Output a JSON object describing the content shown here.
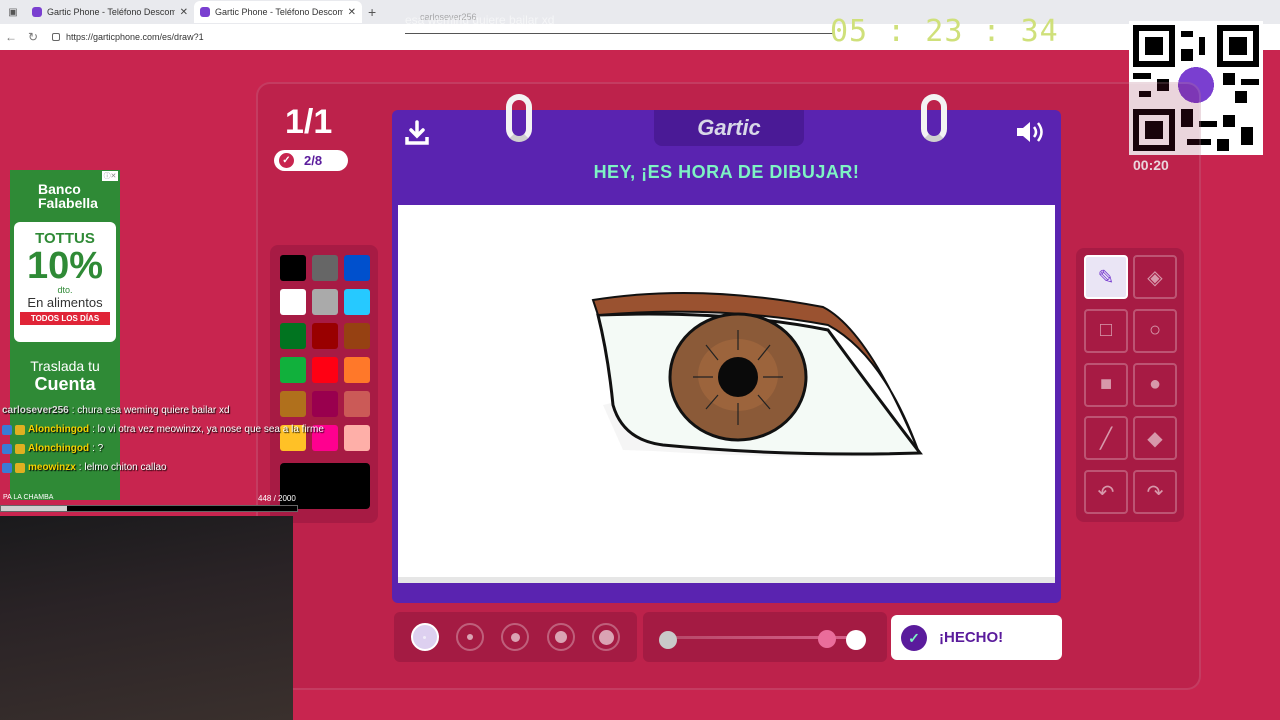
{
  "browser": {
    "tabs": [
      {
        "title": "Gartic Phone - Teléfono Descomp",
        "active": false
      },
      {
        "title": "Gartic Phone - Teléfono Descomp",
        "active": true
      }
    ],
    "url": "https://garticphone.com/es/draw?1"
  },
  "overlay": {
    "marquee": "esa weming quiere bailar xd",
    "marquee_user": "carlosever256",
    "stream_timer": "05 : 23 : 34",
    "qr_timer": "00:20"
  },
  "game": {
    "round": "1/1",
    "players_done": "2/8",
    "logo": "Gartic",
    "prompt": "HEY, ¡ES HORA DE DIBUJAR!",
    "done_label": "¡HECHO!",
    "colors": [
      "#000000",
      "#666666",
      "#0050cd",
      "#ffffff",
      "#aaaaaa",
      "#26c9ff",
      "#017420",
      "#990000",
      "#964112",
      "#11b03c",
      "#ff0013",
      "#ff7829",
      "#b0701c",
      "#99004e",
      "#cb5a57",
      "#ffc126",
      "#ff008f",
      "#feafa8"
    ],
    "current_color": "#000000",
    "tools": [
      "pencil-icon",
      "eraser-icon",
      "rect-outline-icon",
      "circle-outline-icon",
      "rect-fill-icon",
      "circle-fill-icon",
      "line-icon",
      "bucket-icon",
      "undo-icon",
      "redo-icon"
    ],
    "brush_sizes": 5,
    "selected_size": 0
  },
  "ad": {
    "bank": "Banco Falabella",
    "brand": "TOTTUS",
    "percent": "10%",
    "dto": "dto.",
    "foods": "En alimentos",
    "days": "TODOS LOS DÍAS",
    "line1": "Traslada tu",
    "line2": "Cuenta"
  },
  "chat": [
    {
      "user": "carlosever256",
      "text": ": chura esa weming quiere bailar xd"
    },
    {
      "user": "Alonchingod",
      "text": ": lo vi otra vez meowinzx, ya nose que sea a la firme"
    },
    {
      "user": "Alonchingod",
      "text": ": ?"
    },
    {
      "user": "meowinzx",
      "text": ": lelmo chiton callao"
    }
  ],
  "goal": {
    "label": "PA LA CHAMBA",
    "current": 448,
    "total": 2000,
    "text": "448  / 2000"
  }
}
